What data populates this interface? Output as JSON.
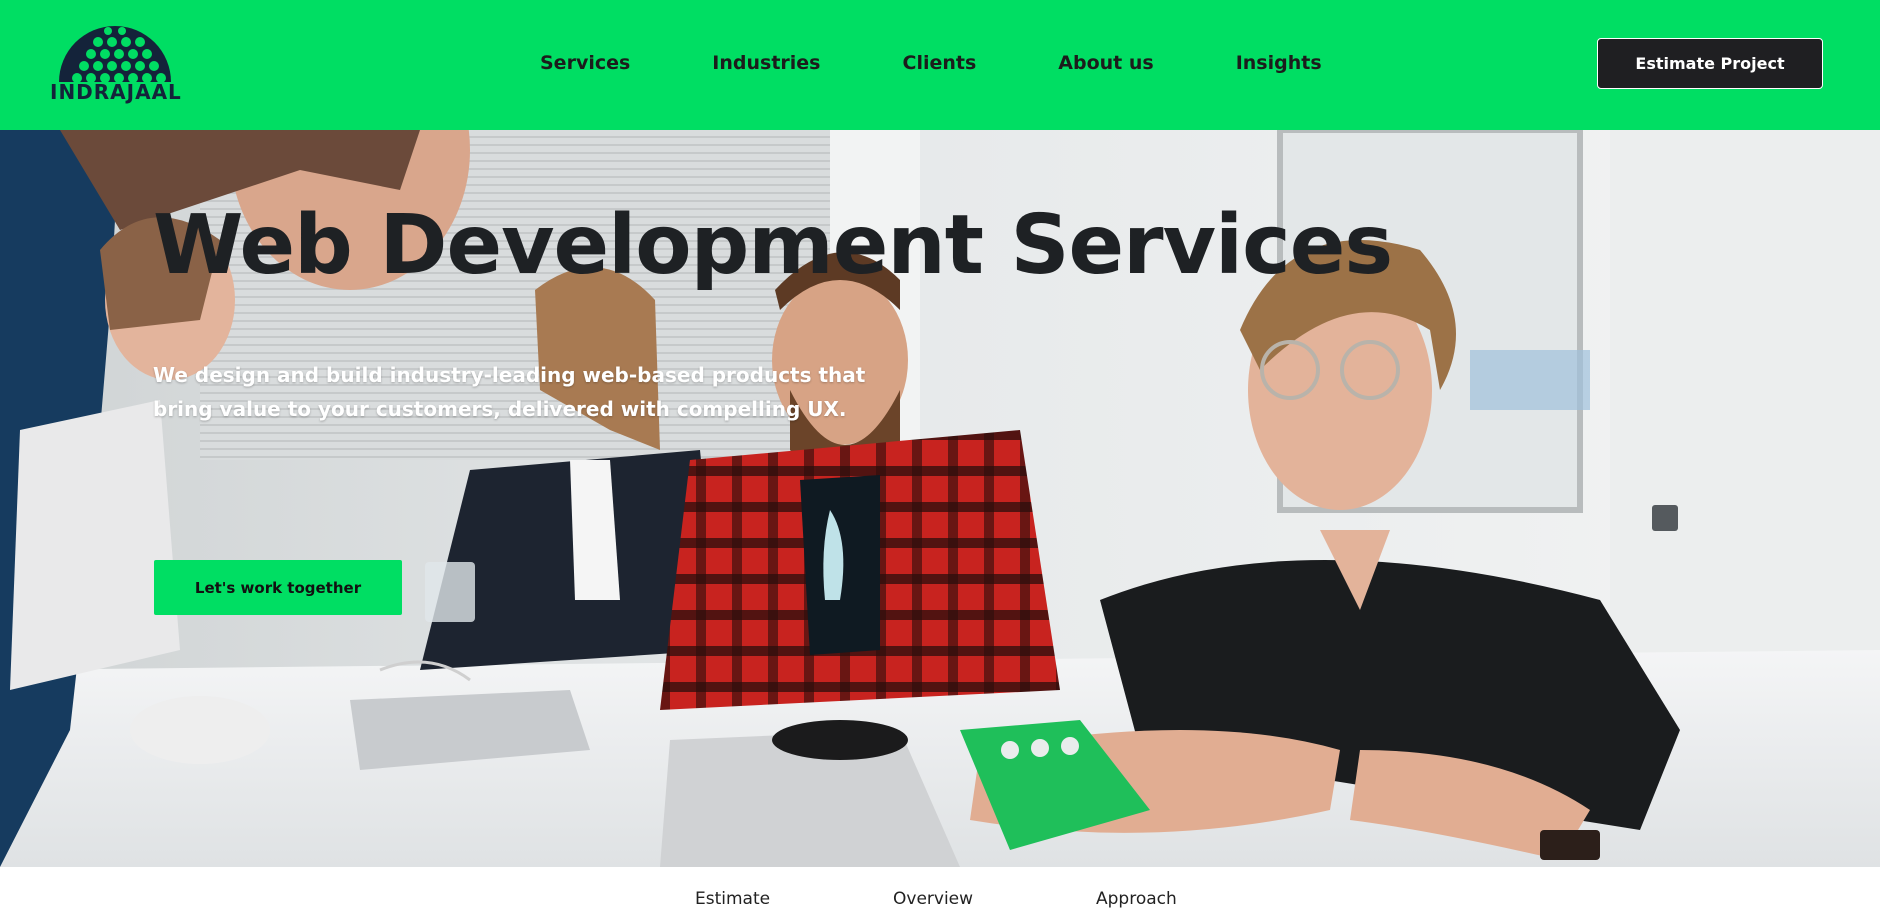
{
  "header": {
    "logo_text": "INDRAJAAL",
    "nav": [
      "Services",
      "Industries",
      "Clients",
      "About us",
      "Insights"
    ],
    "estimate_label": "Estimate Project"
  },
  "hero": {
    "title": "Web Development Services",
    "subtitle": "We design and build industry-leading web-based products that bring value to your customers, delivered with compelling UX.",
    "cta_label": "Let's work together"
  },
  "subnav": [
    "Estimate",
    "Overview",
    "Approach"
  ],
  "colors": {
    "brand_green": "#00de63",
    "dark_button": "#1f1f22",
    "title_text": "#1e2124"
  }
}
